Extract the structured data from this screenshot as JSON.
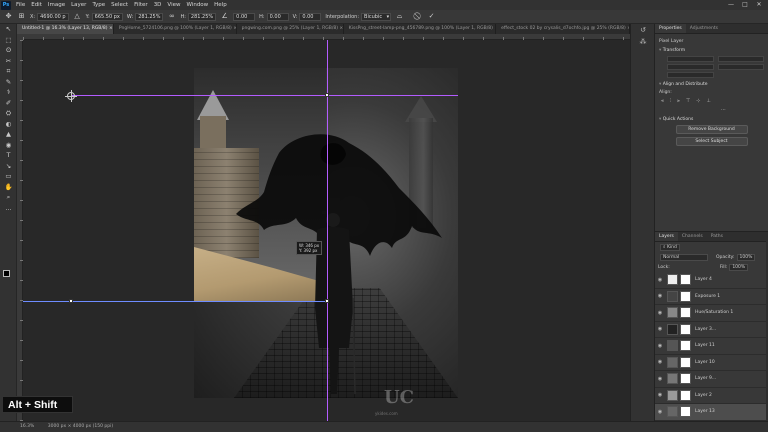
{
  "menu": {
    "logo": "Ps",
    "items": [
      "File",
      "Edit",
      "Image",
      "Layer",
      "Type",
      "Select",
      "Filter",
      "3D",
      "View",
      "Window",
      "Help"
    ],
    "window_controls": [
      "—",
      "□",
      "✕"
    ]
  },
  "options": {
    "x_label": "X:",
    "x_value": "4690.00 p",
    "y_label": "Y:",
    "y_value": "665.50 px",
    "w_label": "W:",
    "w_value": "281.25%",
    "h_label": "H:",
    "h_value": "281.25%",
    "angle_value": "0.00",
    "h_skew_label": "H:",
    "h_skew_value": "0.00",
    "v_skew_label": "V:",
    "v_skew_value": "0.00",
    "interpolation_label": "Interpolation:",
    "interpolation_value": "Bicubic",
    "cancel_icon": "⃠",
    "commit_icon": "✓"
  },
  "tabs": [
    "Untitled-1 @ 16.3% (Layer 13, RGB/8) ×",
    "PngHome_5724106.png @ 100% (Layer 1, RGB/8) ×",
    "pngwing.com.png @ 25% (Layer 1, RGB/8) ×",
    "KissPng_street-lamp-png_456789.png @ 100% (Layer 1, RGB/8) ×",
    "effect_stock 02 by crysalis_d7ochfo.jpg @ 25% (RGB/8) ×"
  ],
  "canvas": {
    "tooltip_w": "W: 346 px",
    "tooltip_h": "Y: 392 px",
    "watermark_logo": "UC",
    "watermark_text": "ykides.com"
  },
  "hotkey": "Alt + Shift",
  "status": {
    "zoom": "16.3%",
    "doc_info": "3000 px × 4000 px (150 ppi)"
  },
  "panels": {
    "tabs_top": [
      "Properties",
      "Adjustments"
    ],
    "pixel_layer": "Pixel Layer",
    "transform_title": "Transform",
    "align_title": "Align and Distribute",
    "align_label": "Align:",
    "quick_actions_title": "Quick Actions",
    "remove_bg": "Remove Background",
    "select_subject": "Select Subject",
    "layers_tabs": [
      "Layers",
      "Channels",
      "Paths"
    ],
    "blend_mode": "Normal",
    "opacity_label": "Opacity:",
    "opacity_value": "100%",
    "lock_label": "Lock:",
    "fill_label": "Fill:",
    "fill_value": "100%",
    "layers": [
      {
        "name": "Layer 4",
        "selected": false
      },
      {
        "name": "Exposure 1",
        "selected": false
      },
      {
        "name": "Hue/Saturation 1",
        "selected": false
      },
      {
        "name": "Layer 3...",
        "selected": false
      },
      {
        "name": "Layer 11",
        "selected": false
      },
      {
        "name": "Layer 10",
        "selected": false
      },
      {
        "name": "Layer 9...",
        "selected": false
      },
      {
        "name": "Layer 2",
        "selected": false
      },
      {
        "name": "Layer 13",
        "selected": true
      }
    ]
  },
  "tools": [
    "↖",
    "⬚",
    "ʘ",
    "✂",
    "⌗",
    "✎",
    "⚕",
    "✐",
    "⛭",
    "◐",
    "▲",
    "◉",
    "T",
    "↘",
    "▭",
    "✋",
    "⌕",
    "…"
  ]
}
